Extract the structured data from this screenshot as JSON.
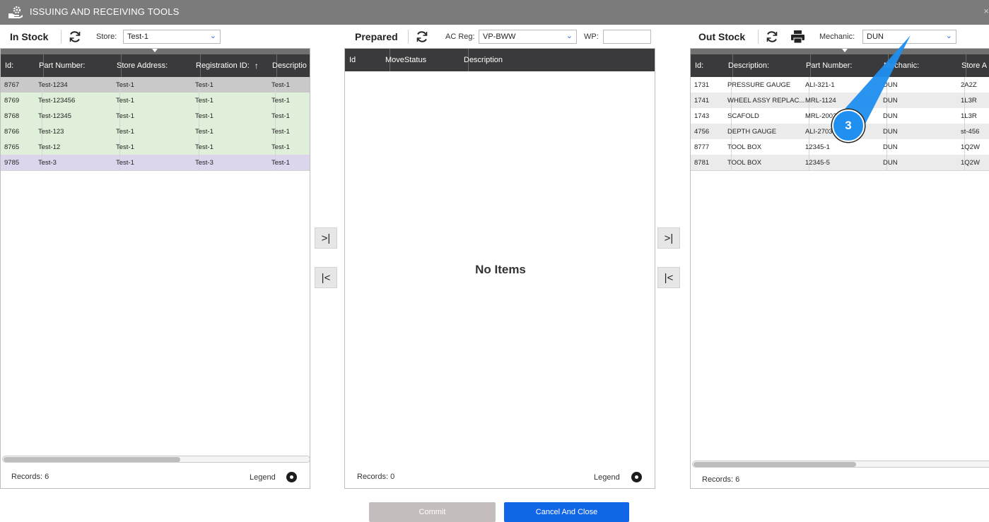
{
  "window": {
    "title": "ISSUING AND RECEIVING TOOLS",
    "close": "×"
  },
  "in_stock": {
    "title": "In Stock",
    "store_label": "Store:",
    "store_value": "Test-1",
    "columns": [
      "Id:",
      "Part Number:",
      "Store Address:",
      "Registration ID:",
      "Descriptio"
    ],
    "rows": [
      {
        "id": "8767",
        "part": "Test-1234",
        "addr": "Test-1",
        "reg": "Test-1",
        "desc": "Test-1",
        "state": "grey"
      },
      {
        "id": "8769",
        "part": "Test-123456",
        "addr": "Test-1",
        "reg": "Test-1",
        "desc": "Test-1",
        "state": "green"
      },
      {
        "id": "8768",
        "part": "Test-12345",
        "addr": "Test-1",
        "reg": "Test-1",
        "desc": "Test-1",
        "state": "green"
      },
      {
        "id": "8766",
        "part": "Test-123",
        "addr": "Test-1",
        "reg": "Test-1",
        "desc": "Test-1",
        "state": "green"
      },
      {
        "id": "8765",
        "part": "Test-12",
        "addr": "Test-1",
        "reg": "Test-1",
        "desc": "Test-1",
        "state": "green"
      },
      {
        "id": "9785",
        "part": "Test-3",
        "addr": "Test-1",
        "reg": "Test-3",
        "desc": "Test-1",
        "state": "purple"
      }
    ],
    "records": "Records: 6",
    "legend": "Legend"
  },
  "prepared": {
    "title": "Prepared",
    "acreg_label": "AC Reg:",
    "acreg_value": "VP-BWW",
    "wp_label": "WP:",
    "wp_value": "",
    "columns": [
      "Id",
      "MoveStatus",
      "Description"
    ],
    "empty": "No Items",
    "records": "Records: 0",
    "legend": "Legend"
  },
  "out_stock": {
    "title": "Out Stock",
    "mechanic_label": "Mechanic:",
    "mechanic_value": "DUN",
    "columns": [
      "Id:",
      "Description:",
      "Part Number:",
      "Mechanic:",
      "Store A"
    ],
    "rows": [
      {
        "id": "1731",
        "desc": "PRESSURE GAUGE",
        "part": "ALI-321-1",
        "mech": "DUN",
        "store": "2A2Z",
        "state": "white"
      },
      {
        "id": "1741",
        "desc": "WHEEL ASSY REPLAC...",
        "part": "MRL-1124",
        "mech": "DUN",
        "store": "1L3R",
        "state": "lgrey"
      },
      {
        "id": "1743",
        "desc": "SCAFOLD",
        "part": "MRL-2002",
        "mech": "DUN",
        "store": "1L3R",
        "state": "white"
      },
      {
        "id": "4756",
        "desc": "DEPTH GAUGE",
        "part": "ALI-2703",
        "mech": "DUN",
        "store": "st-456",
        "state": "lgrey"
      },
      {
        "id": "8777",
        "desc": "TOOL BOX",
        "part": "12345-1",
        "mech": "DUN",
        "store": "1Q2W",
        "state": "white"
      },
      {
        "id": "8781",
        "desc": "TOOL BOX",
        "part": "12345-5",
        "mech": "DUN",
        "store": "1Q2W",
        "state": "lgrey"
      }
    ],
    "records": "Records: 6"
  },
  "move": {
    "to_last": ">|",
    "to_first": "|<"
  },
  "actions": {
    "commit": "Commit",
    "cancel": "Cancel And Close"
  },
  "callout": {
    "number": "3"
  },
  "icons": [
    "tools-hand-icon",
    "refresh-icon",
    "print-icon",
    "chevron-down-icon",
    "eye-icon",
    "sort-up-arrow-icon"
  ],
  "colors": {
    "titlebar": "#7b7b7b",
    "header": "#3a3a3c",
    "primary": "#1166e8",
    "disabled": "#c4bdbd",
    "callout": "#1f8ff0"
  }
}
